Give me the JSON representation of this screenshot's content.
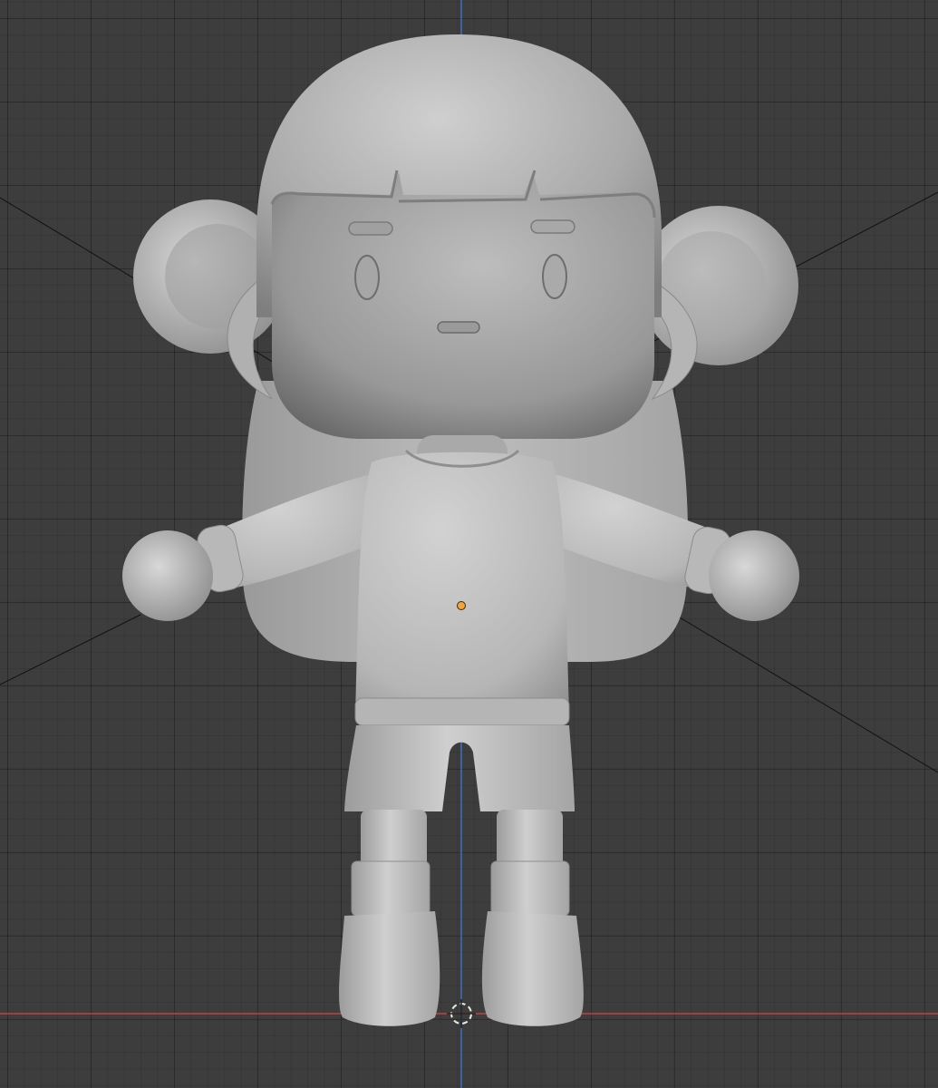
{
  "viewport": {
    "type": "3D viewport",
    "background_color": "#3d3d3d",
    "grid_color": "#2e2e2e",
    "x_axis_color": "#c0453f",
    "z_axis_color": "#3f6fbf",
    "object_origin_color": "#f2a33a",
    "cursor_color": "#e8e8e8"
  },
  "model": {
    "description_icon": "character-sculpt",
    "material_color": "#b8b8b8"
  }
}
